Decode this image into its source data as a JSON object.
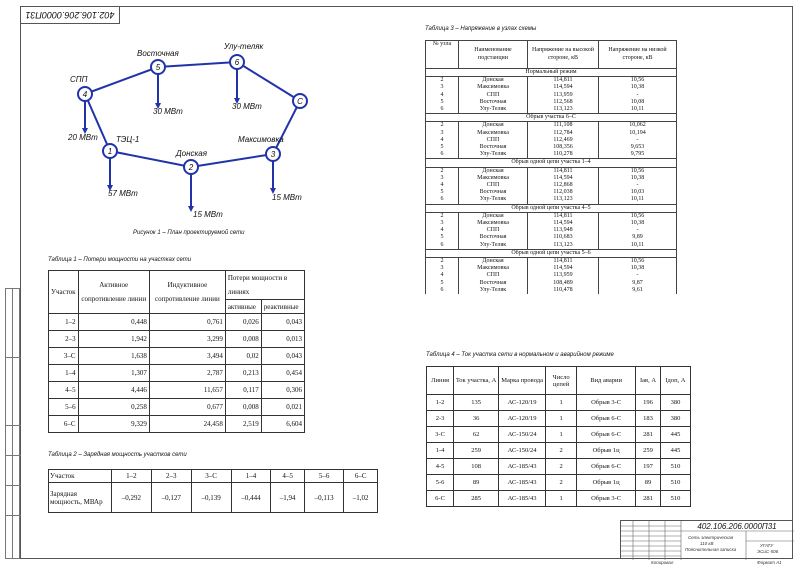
{
  "doc": {
    "top_code": "402.106.206.0000П31",
    "figure_caption": "Рисунок 1 – План проектируемой сети",
    "table1_caption": "Таблица 1 – Потери мощности на участках сети",
    "table2_caption": "Таблица 2 – Зарядная мощность участков сети",
    "table3_caption": "Таблица 3 – Напряжение в узлах схемы",
    "table4_caption": "Таблица 4 – Ток участка сети в нормальном и аварийном режиме"
  },
  "diagram": {
    "nodes": [
      {
        "id": "1",
        "label": "ТЭЦ-1"
      },
      {
        "id": "2",
        "label": "Донская"
      },
      {
        "id": "3",
        "label": "Максимовка"
      },
      {
        "id": "4",
        "label": "СПП"
      },
      {
        "id": "5",
        "label": "Восточная"
      },
      {
        "id": "6",
        "label": "Улу-теляк"
      },
      {
        "id": "С",
        "label": ""
      }
    ],
    "loads": [
      "20 МВт",
      "30 МВт",
      "30 МВт",
      "57 МВт",
      "15 МВт",
      "15 МВт"
    ]
  },
  "table1": {
    "headers": [
      "Участок",
      "Активное сопротивление линии",
      "Индуктивное сопротивление линии",
      "Потери мощности в линиях",
      "активные",
      "реактивные"
    ],
    "rows": [
      [
        "1–2",
        "0,448",
        "0,761",
        "0,026",
        "0,043"
      ],
      [
        "2–3",
        "1,942",
        "3,299",
        "0,008",
        "0,013"
      ],
      [
        "3–С",
        "1,638",
        "3,494",
        "0,02",
        "0,043"
      ],
      [
        "1–4",
        "1,307",
        "2,787",
        "0,213",
        "0,454"
      ],
      [
        "4–5",
        "4,446",
        "11,657",
        "0,117",
        "0,306"
      ],
      [
        "5–6",
        "0,258",
        "0,677",
        "0,008",
        "0,021"
      ],
      [
        "6–С",
        "9,329",
        "24,458",
        "2,519",
        "6,604"
      ]
    ]
  },
  "table2": {
    "row_header": [
      "Участок",
      "Зарядная мощность, МВАр"
    ],
    "sections": [
      "1–2",
      "2–3",
      "3–С",
      "1–4",
      "4–5",
      "5–6",
      "6–С"
    ],
    "values": [
      "–0,292",
      "–0,127",
      "–0,139",
      "–0,444",
      "–1,94",
      "–0,113",
      "–1,02"
    ]
  },
  "table3": {
    "headers": [
      "№ узла",
      "Наименование подстанции",
      "Напряжение на высокой стороне, кВ",
      "Напряжение на низкой стороне, кВ"
    ],
    "sections": [
      {
        "title": "Нормальный режим",
        "rows": [
          [
            "2",
            "Донская",
            "114,811",
            "10,56"
          ],
          [
            "3",
            "Максимовка",
            "114,594",
            "10,38"
          ],
          [
            "4",
            "СПП",
            "113,959",
            "-"
          ],
          [
            "5",
            "Восточная",
            "112,568",
            "10,08"
          ],
          [
            "6",
            "Улу-Теляк",
            "113,123",
            "10,11"
          ]
        ]
      },
      {
        "title": "Обрыв участка 6–С",
        "rows": [
          [
            "2",
            "Донская",
            "111,108",
            "10,062"
          ],
          [
            "3",
            "Максимовка",
            "112,784",
            "10,194"
          ],
          [
            "4",
            "СПП",
            "112,469",
            "-"
          ],
          [
            "5",
            "Восточная",
            "108,356",
            "9,653"
          ],
          [
            "6",
            "Улу-Теляк",
            "110,278",
            "9,795"
          ]
        ]
      },
      {
        "title": "Обрыв одной цепи участка 1–4",
        "rows": [
          [
            "2",
            "Донская",
            "114,811",
            "10,56"
          ],
          [
            "3",
            "Максимовка",
            "114,594",
            "10,38"
          ],
          [
            "4",
            "СПП",
            "112,868",
            "-"
          ],
          [
            "5",
            "Восточная",
            "112,038",
            "10,03"
          ],
          [
            "6",
            "Улу-Теляк",
            "113,123",
            "10,11"
          ]
        ]
      },
      {
        "title": "Обрыв одной цепи участка 4–5",
        "rows": [
          [
            "2",
            "Донская",
            "114,811",
            "10,56"
          ],
          [
            "3",
            "Максимовка",
            "114,594",
            "10,38"
          ],
          [
            "4",
            "СПП",
            "113,948",
            "-"
          ],
          [
            "5",
            "Восточная",
            "110,683",
            "9,89"
          ],
          [
            "6",
            "Улу-Теляк",
            "113,123",
            "10,11"
          ]
        ]
      },
      {
        "title": "Обрыв одной цепи участка 5–6",
        "rows": [
          [
            "2",
            "Донская",
            "114,811",
            "10,56"
          ],
          [
            "3",
            "Максимовка",
            "114,594",
            "10,38"
          ],
          [
            "4",
            "СПП",
            "113,959",
            "-"
          ],
          [
            "5",
            "Восточная",
            "108,489",
            "9,87"
          ],
          [
            "6",
            "Улу-Теляк",
            "110,478",
            "9,61"
          ]
        ]
      }
    ]
  },
  "table4": {
    "headers": [
      "Линия",
      "Ток участка, А",
      "Марка провода",
      "Число цепей",
      "Вид аварии",
      "Iав, А",
      "Iдоп, А"
    ],
    "rows": [
      [
        "1-2",
        "135",
        "АС-120/19",
        "1",
        "Обрыв 3-С",
        "196",
        "380"
      ],
      [
        "2-3",
        "36",
        "АС-120/19",
        "1",
        "Обрыв 6-С",
        "183",
        "380"
      ],
      [
        "3-С",
        "62",
        "АС-150/24",
        "1",
        "Обрыв 6-С",
        "281",
        "445"
      ],
      [
        "1-4",
        "259",
        "АС-150/24",
        "2",
        "Обрыв 1ц",
        "259",
        "445"
      ],
      [
        "4-5",
        "108",
        "АС-185/43",
        "2",
        "Обрыв 6-С",
        "197",
        "510"
      ],
      [
        "5-6",
        "89",
        "АС-185/43",
        "2",
        "Обрыв 1ц",
        "89",
        "510"
      ],
      [
        "6-С",
        "285",
        "АС-185/43",
        "1",
        "Обрыв 3-С",
        "281",
        "510"
      ]
    ]
  },
  "titleblock": {
    "code": "402.106.206.0000П31",
    "title_line1": "Сеть электрическая",
    "title_line2": "110 кВ",
    "title_line3": "Пояснительная записка",
    "org_line1": "УГАТУ",
    "org_line2": "ЭСиС-506",
    "format": "Формат А1",
    "copied": "Копировал"
  }
}
